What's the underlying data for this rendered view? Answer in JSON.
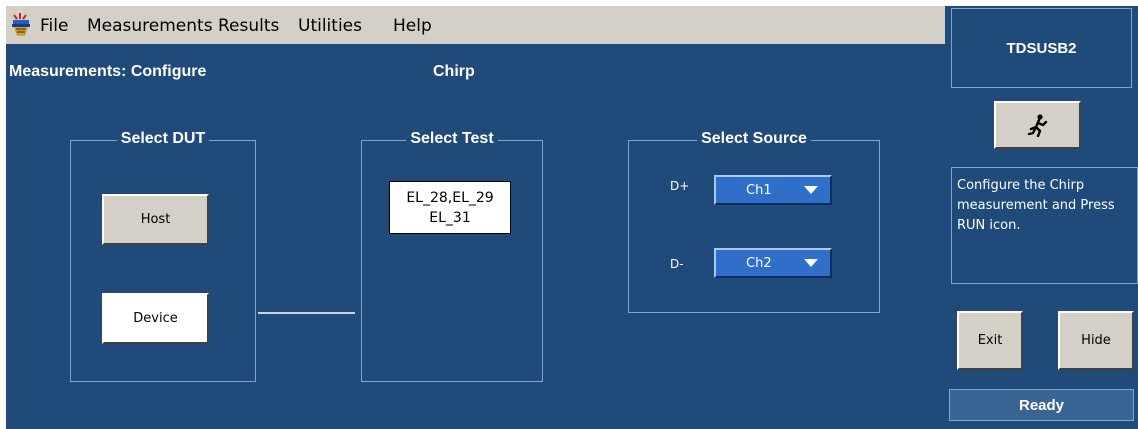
{
  "menu": {
    "items": [
      "File",
      "Measurements",
      "Results",
      "Utilities",
      "Help"
    ]
  },
  "main": {
    "title": "Measurements: Configure",
    "subtitle": "Chirp",
    "select_dut": {
      "legend": "Select DUT",
      "host_label": "Host",
      "device_label": "Device",
      "selected": "Device"
    },
    "select_test": {
      "legend": "Select Test",
      "line1": "EL_28,EL_29",
      "line2": "EL_31"
    },
    "select_source": {
      "legend": "Select Source",
      "dplus_label": "D+",
      "dplus_value": "Ch1",
      "dminus_label": "D-",
      "dminus_value": "Ch2"
    }
  },
  "side": {
    "title": "TDSUSB2",
    "run_icon": "running-man-icon",
    "message": "Configure the Chirp measurement and Press RUN icon.",
    "exit_label": "Exit",
    "hide_label": "Hide",
    "status": "Ready"
  },
  "colors": {
    "panel_blue": "#1f4a79",
    "menu_gray": "#d4d0c8",
    "dropdown_blue": "#2f6fc9",
    "group_border": "#7ea4cf"
  }
}
